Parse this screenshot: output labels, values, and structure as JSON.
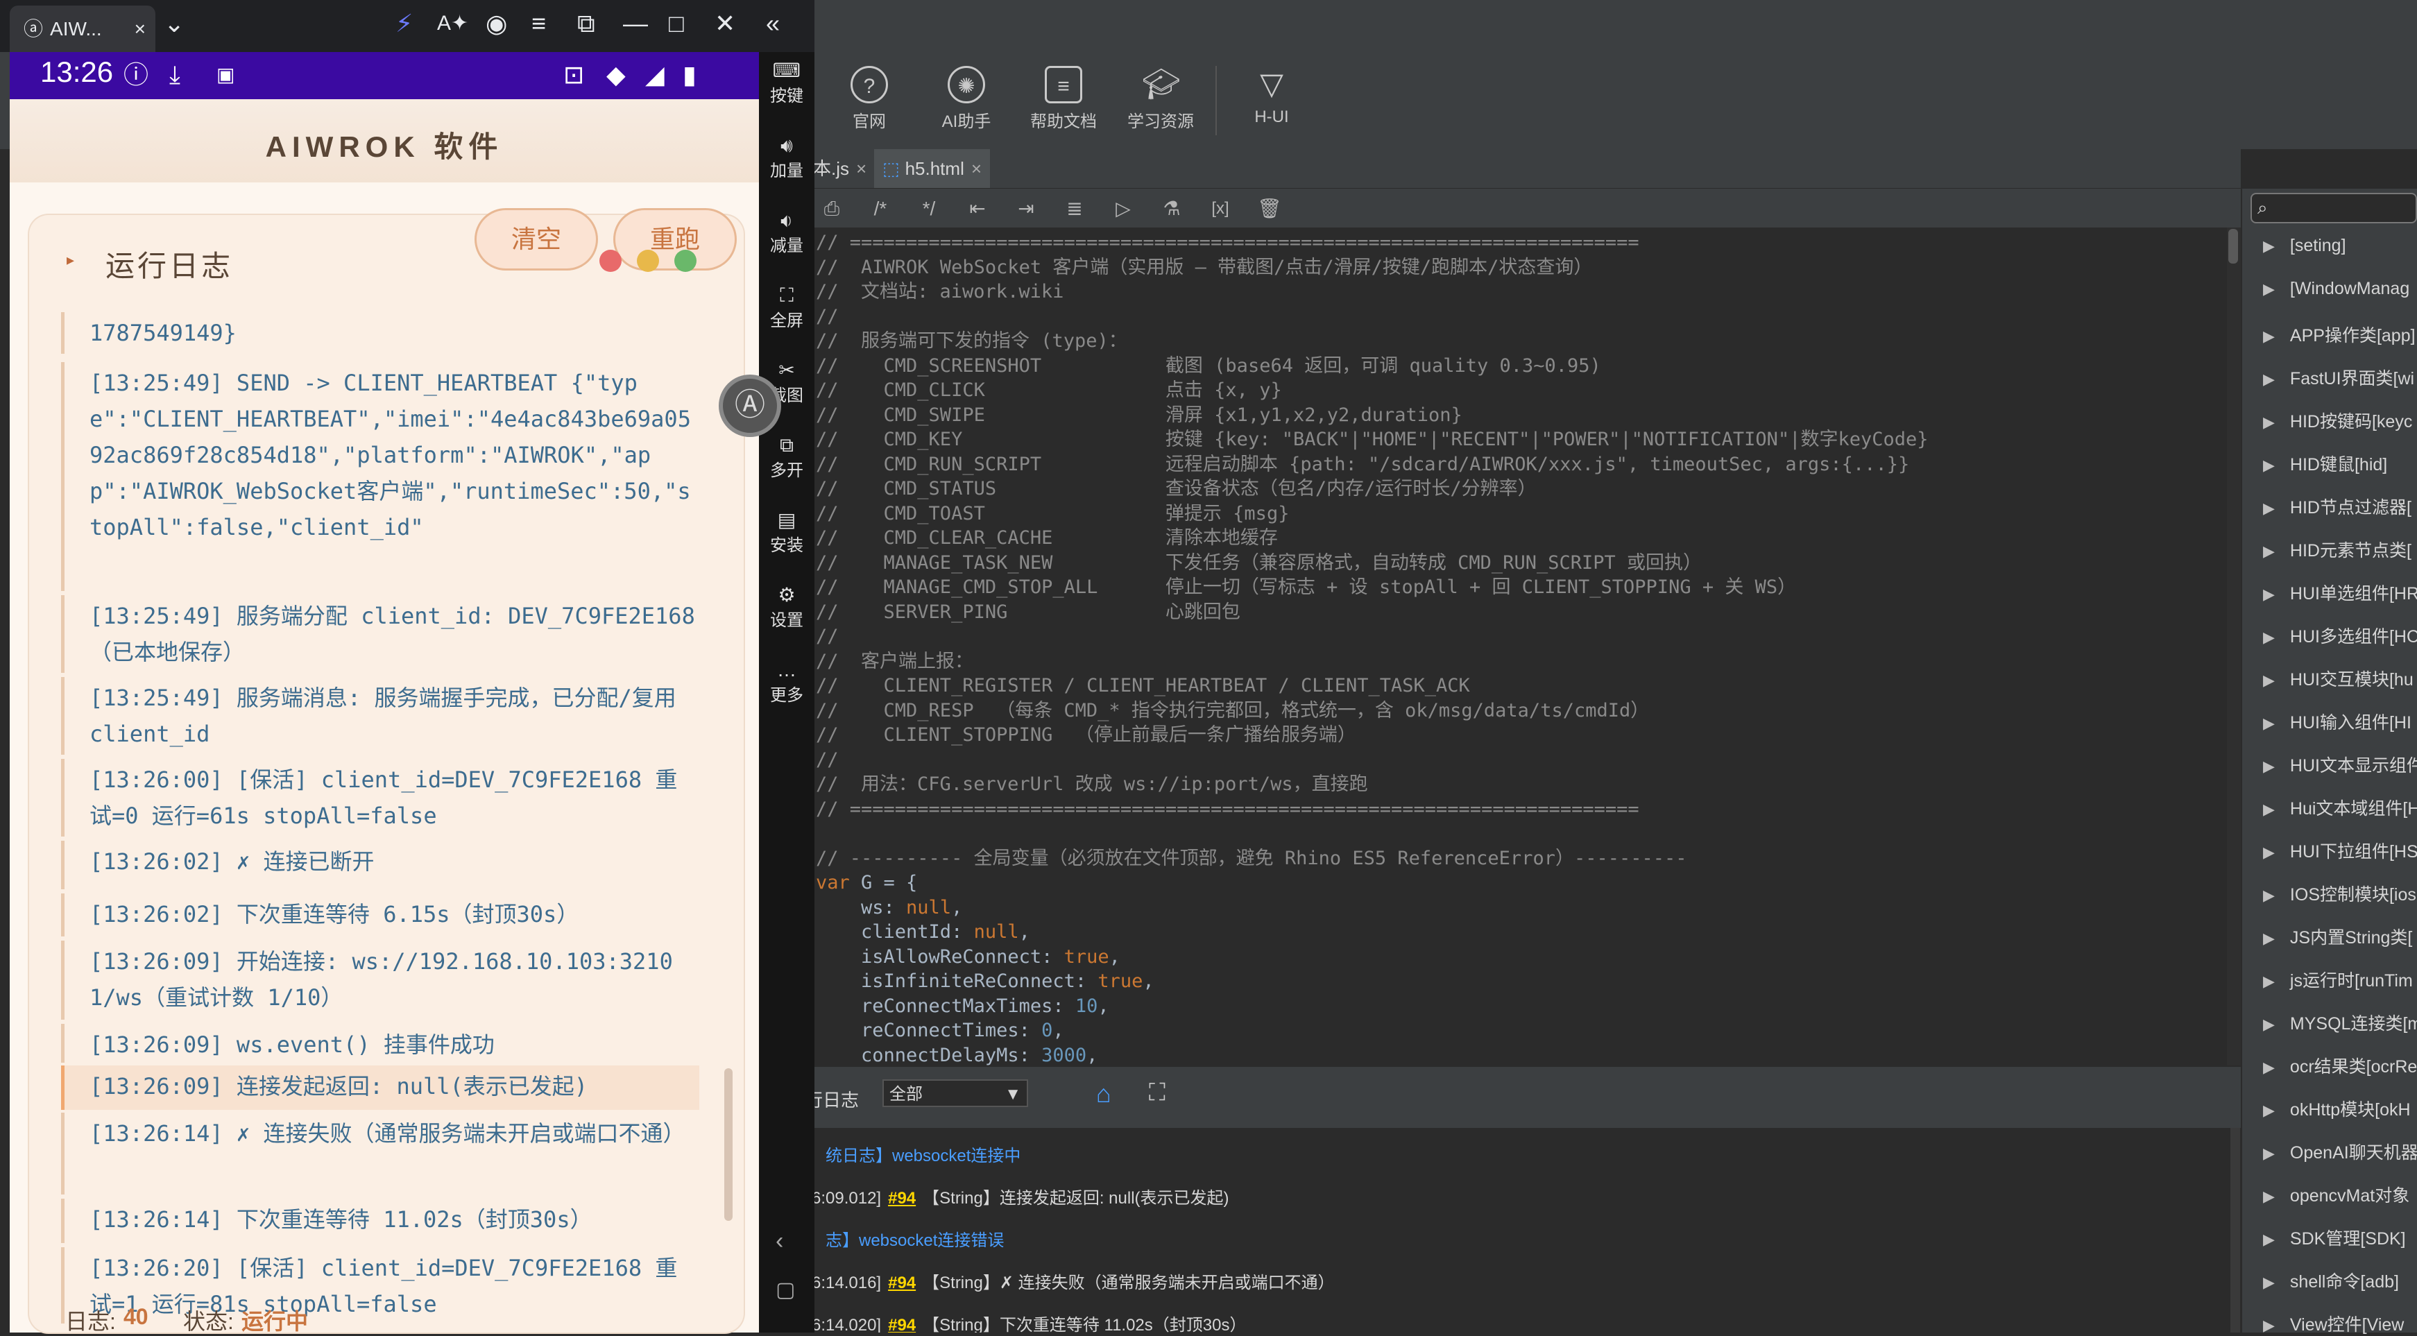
{
  "browser": {
    "tab_title": "AIW...",
    "tab_close": "×"
  },
  "phone_status": {
    "time": "13:26"
  },
  "app": {
    "title": "AIWROK 软件",
    "log_card_title": "运行日志",
    "clear_button": "清空",
    "rerun_button": "重跑",
    "log_entries": [
      "1787549149}",
      "[13:25:49] SEND -> CLIENT_HEARTBEAT {\"type\":\"CLIENT_HEARTBEAT\",\"imei\":\"4e4ac843be69a0592ac869f28c854d18\",\"platform\":\"AIWROK\",\"app\":\"AIWROK_WebSocket客户端\",\"runtimeSec\":50,\"stopAll\":false,\"client_id\"",
      "[13:25:49] 服务端分配 client_id: DEV_7C9FE2E168（已本地保存）",
      "[13:25:49] 服务端消息: 服务端握手完成，已分配/复用 client_id",
      "[13:26:00] [保活] client_id=DEV_7C9FE2E168 重试=0 运行=61s stopAll=false",
      "[13:26:02] ✗ 连接已断开",
      "[13:26:02] 下次重连等待 6.15s（封顶30s）",
      "[13:26:09] 开始连接: ws://192.168.10.103:32101/ws（重试计数 1/10）",
      "[13:26:09] ws.event() 挂事件成功",
      "[13:26:09] 连接发起返回: null(表示已发起)",
      "[13:26:14] ✗ 连接失败（通常服务端未开启或端口不通）",
      "[13:26:14] 下次重连等待 11.02s（封顶30s）",
      "[13:26:20] [保活] client_id=DEV_7C9FE2E168 重试=1 运行=81s stopAll=false"
    ],
    "footer_log_label": "日志:",
    "footer_log_count": "40",
    "footer_state_label": "状态:",
    "footer_state_value": "运行中"
  },
  "emulator_side": [
    {
      "label": "按键",
      "icon": "keyboard-icon"
    },
    {
      "label": "加量",
      "icon": "volume-up-icon"
    },
    {
      "label": "减量",
      "icon": "volume-down-icon"
    },
    {
      "label": "全屏",
      "icon": "fullscreen-icon"
    },
    {
      "label": "截图",
      "icon": "scissors-icon"
    },
    {
      "label": "多开",
      "icon": "multi-open-icon"
    },
    {
      "label": "安装",
      "icon": "apk-install-icon"
    },
    {
      "label": "设置",
      "icon": "settings-icon"
    },
    {
      "label": "更多",
      "icon": "more-icon"
    }
  ],
  "ide_toolbar": [
    {
      "label": "官网",
      "icon": "help-circle-icon"
    },
    {
      "label": "AI助手",
      "icon": "ai-assistant-icon"
    },
    {
      "label": "帮助文档",
      "icon": "document-icon"
    },
    {
      "label": "学习资源",
      "icon": "graduation-cap-icon"
    },
    {
      "label": "H-UI",
      "icon": "h-ui-logo-icon"
    }
  ],
  "tabs": [
    {
      "label": "本.js",
      "active": false
    },
    {
      "label": "h5.html",
      "active": true
    }
  ],
  "code_lines": [
    {
      "text": "// ======================================================================",
      "cls": "cmt"
    },
    {
      "text": "//  AIWROK WebSocket 客户端（实用版 – 带截图/点击/滑屏/按键/跑脚本/状态查询）",
      "cls": "cmt"
    },
    {
      "text": "//  文档站: aiwork.wiki",
      "cls": "cmt"
    },
    {
      "text": "//",
      "cls": "cmt"
    },
    {
      "text": "//  服务端可下发的指令 (type)：",
      "cls": "cmt"
    },
    {
      "text": "//    CMD_SCREENSHOT           截图 (base64 返回，可调 quality 0.3~0.95)",
      "cls": "cmt"
    },
    {
      "text": "//    CMD_CLICK                点击 {x, y}",
      "cls": "cmt"
    },
    {
      "text": "//    CMD_SWIPE                滑屏 {x1,y1,x2,y2,duration}",
      "cls": "cmt"
    },
    {
      "text": "//    CMD_KEY                  按键 {key: \"BACK\"|\"HOME\"|\"RECENT\"|\"POWER\"|\"NOTIFICATION\"|数字keyCode}",
      "cls": "cmt"
    },
    {
      "text": "//    CMD_RUN_SCRIPT           远程启动脚本 {path: \"/sdcard/AIWROK/xxx.js\", timeoutSec, args:{...}}",
      "cls": "cmt"
    },
    {
      "text": "//    CMD_STATUS               查设备状态（包名/内存/运行时长/分辨率）",
      "cls": "cmt"
    },
    {
      "text": "//    CMD_TOAST                弹提示 {msg}",
      "cls": "cmt"
    },
    {
      "text": "//    CMD_CLEAR_CACHE          清除本地缓存",
      "cls": "cmt"
    },
    {
      "text": "//    MANAGE_TASK_NEW          下发任务（兼容原格式，自动转成 CMD_RUN_SCRIPT 或回执）",
      "cls": "cmt"
    },
    {
      "text": "//    MANAGE_CMD_STOP_ALL      停止一切（写标志 + 设 stopAll + 回 CLIENT_STOPPING + 关 WS）",
      "cls": "cmt"
    },
    {
      "text": "//    SERVER_PING              心跳回包",
      "cls": "cmt"
    },
    {
      "text": "//",
      "cls": "cmt"
    },
    {
      "text": "//  客户端上报：",
      "cls": "cmt"
    },
    {
      "text": "//    CLIENT_REGISTER / CLIENT_HEARTBEAT / CLIENT_TASK_ACK",
      "cls": "cmt"
    },
    {
      "text": "//    CMD_RESP  （每条 CMD_* 指令执行完都回，格式统一，含 ok/msg/data/ts/cmdId）",
      "cls": "cmt"
    },
    {
      "text": "//    CLIENT_STOPPING  （停止前最后一条广播给服务端）",
      "cls": "cmt"
    },
    {
      "text": "//",
      "cls": "cmt"
    },
    {
      "text": "//  用法：CFG.serverUrl 改成 ws://ip:port/ws，直接跑",
      "cls": "cmt"
    },
    {
      "text": "// ======================================================================",
      "cls": "cmt"
    },
    {
      "text": "",
      "cls": ""
    },
    {
      "text": "// ---------- 全局变量（必须放在文件顶部，避免 Rhino ES5 ReferenceError）----------",
      "cls": "cmt"
    },
    {
      "text": "var G = {",
      "cls": "code"
    },
    {
      "text": "    ws: null,",
      "cls": "code"
    },
    {
      "text": "    clientId: null,",
      "cls": "code"
    },
    {
      "text": "    isAllowReConnect: true,",
      "cls": "code"
    },
    {
      "text": "    isInfiniteReConnect: true,",
      "cls": "code"
    },
    {
      "text": "    reConnectMaxTimes: 10,",
      "cls": "code"
    },
    {
      "text": "    reConnectTimes: 0,",
      "cls": "code"
    },
    {
      "text": "    connectDelayMs: 3000,",
      "cls": "code"
    }
  ],
  "log_panel": {
    "title": "行日志",
    "filter_value": "全部",
    "lines": [
      {
        "prefix": "",
        "tag": "",
        "text": "统日志】websocket连接中",
        "blue": true
      },
      {
        "prefix": "6:09.012]",
        "tag": "#94",
        "text": "【String】连接发起返回: null(表示已发起)",
        "blue": false
      },
      {
        "prefix": "",
        "tag": "",
        "text": "志】websocket连接错误",
        "blue": true
      },
      {
        "prefix": "6:14.016]",
        "tag": "#94",
        "text": "【String】✗ 连接失败（通常服务端未开启或端口不通）",
        "blue": false
      },
      {
        "prefix": "6:14.020]",
        "tag": "#94",
        "text": "【String】下次重连等待 11.02s（封顶30s）",
        "blue": false
      }
    ]
  },
  "api_tree": [
    "[seting]",
    "[WindowManag",
    "APP操作类[app]",
    "FastUI界面类[wi",
    "HID按键码[keyc",
    "HID键鼠[hid]",
    "HID节点过滤器[",
    "HID元素节点类[",
    "HUI单选组件[HR",
    "HUI多选组件[HC",
    "HUI交互模块[hu",
    "HUI输入组件[HI",
    "HUI文本显示组件",
    "Hui文本域组件[H",
    "HUI下拉组件[HS",
    "IOS控制模块[ios",
    "JS内置String类[",
    "js运行时[runTim",
    "MYSQL连接类[m",
    "ocr结果类[ocrRe",
    "okHttp模块[okH",
    "OpenAI聊天机器",
    "opencvMat对象",
    "SDK管理[SDK]",
    "shell命令[adb]",
    "View控件[View"
  ]
}
